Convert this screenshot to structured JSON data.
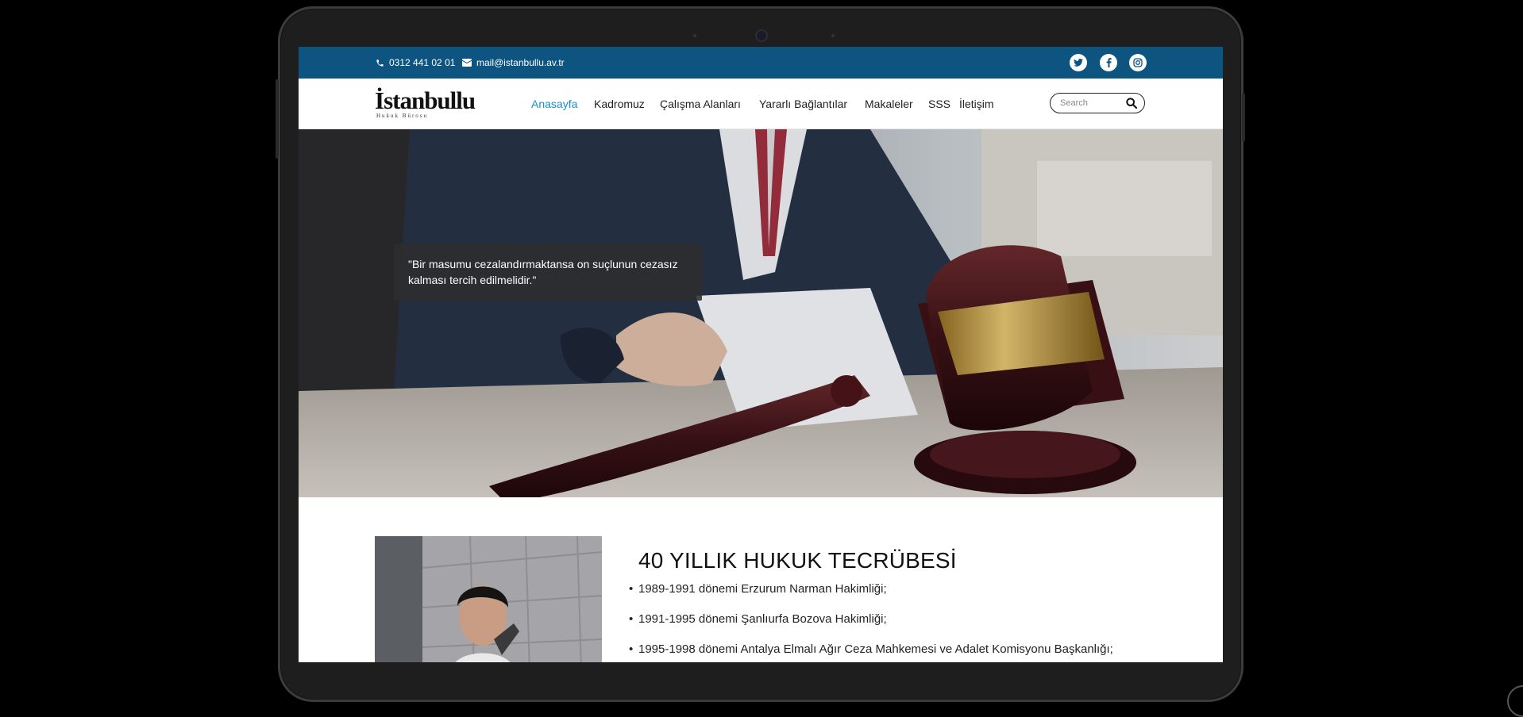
{
  "topbar": {
    "phone": "0312 441 02 01",
    "email": "mail@istanbullu.av.tr",
    "social": [
      "twitter-icon",
      "facebook-icon",
      "instagram-icon"
    ]
  },
  "logo": {
    "name": "İstanbullu",
    "subtitle": "Hukuk Bürosu"
  },
  "nav": {
    "items": [
      "Anasayfa",
      "Kadromuz",
      "Çalışma Alanları",
      "Yararlı Bağlantılar",
      "Makaleler",
      "SSS",
      "İletişim"
    ],
    "active": "Anasayfa"
  },
  "search": {
    "placeholder": "Search"
  },
  "hero": {
    "quote": "\"Bir masumu cezalandırmaktansa on suçlunun cezasız kalması tercih edilmelidir.\""
  },
  "about": {
    "title": "40 YILLIK HUKUK TECRÜBESİ",
    "items": [
      "1989-1991 dönemi Erzurum Narman Hakimliği;",
      "1991-1995 dönemi Şanlıurfa Bozova Hakimliği;",
      "1995-1998 dönemi Antalya Elmalı Ağır Ceza Mahkemesi ve Adalet Komisyonu Başkanlığı;"
    ]
  },
  "colors": {
    "topbar": "#0d5580",
    "active_nav": "#1a8fd0",
    "quote_bg": "#2d2d2d"
  }
}
